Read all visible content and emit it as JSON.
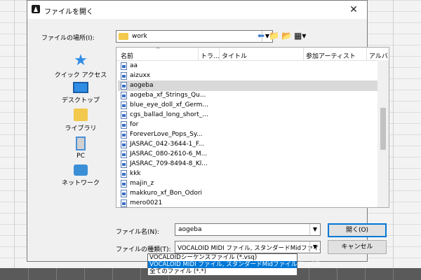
{
  "dialog": {
    "title": "ファイルを開く",
    "close_glyph": "✕",
    "location_label": "ファイルの場所(I):",
    "location_value": "work",
    "toolbar": {
      "back": "⬅",
      "up": "📁",
      "new_folder": "📂",
      "view": "▦▾"
    },
    "places": [
      {
        "label": "クイック アクセス",
        "icon": "star-icon"
      },
      {
        "label": "デスクトップ",
        "icon": "desktop-icon"
      },
      {
        "label": "ライブラリ",
        "icon": "library-icon"
      },
      {
        "label": "PC",
        "icon": "pc-icon"
      },
      {
        "label": "ネットワーク",
        "icon": "network-icon"
      }
    ],
    "columns": [
      "名前",
      "トラ...",
      "タイトル",
      "参加アーティスト",
      "アルバ"
    ],
    "files": [
      "aa",
      "aizuxx",
      "aogeba",
      "aogeba_xf_Strings_Qu...",
      "blue_eye_doll_xf_Germ...",
      "cgs_ballad_long_short_...",
      "for",
      "ForeverLove_Pops_Sy...",
      "JASRAC_042-3644-1_F...",
      "JASRAC_080-2610-6_M...",
      "JASRAC_709-8494-8_Kl...",
      "kkk",
      "majin_z",
      "makkuro_xf_Bon_Odori",
      "mero0021"
    ],
    "selected_file": "aogeba",
    "filename_label": "ファイル名(N):",
    "filename_value": "aogeba",
    "filetype_label": "ファイルの種類(T):",
    "filetype_value": "VOCALOID MIDI ファイル, スタンダードMidファイル (*.mid)",
    "open_button": "開く(O)",
    "cancel_button": "キャンセル",
    "filetype_options": [
      "VOCALOIDシーケンスファイル (*.vsq)",
      "VOCALOID MIDI ファイル, スタンダードMidファイル (*.mid)",
      "全てのファイル (*.*)"
    ],
    "selected_option_index": 1
  },
  "colors": {
    "accent": "#0078d7",
    "selection": "#d9d9d9",
    "folder": "#f2c94c"
  }
}
